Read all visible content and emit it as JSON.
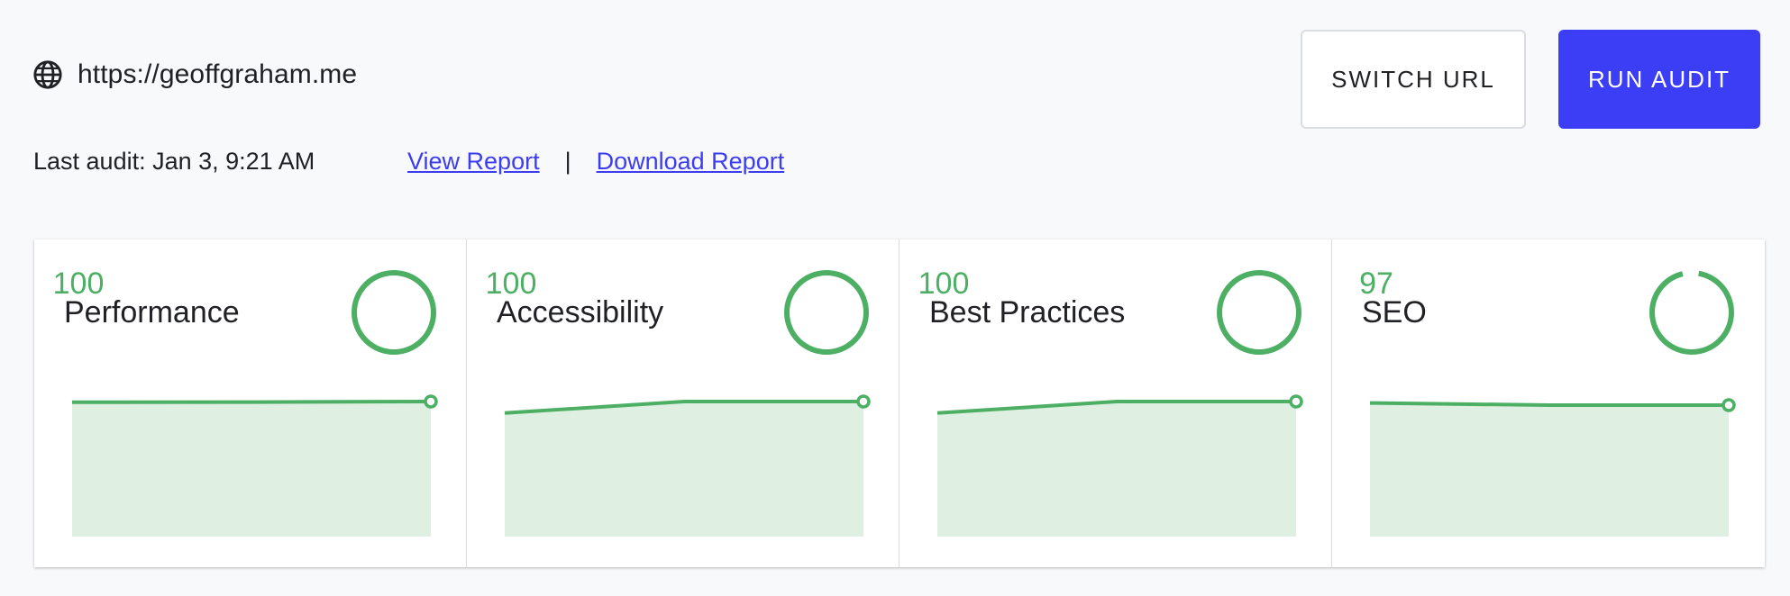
{
  "header": {
    "url": "https://geoffgraham.me",
    "globe_icon": "globe-icon",
    "last_audit": "Last audit: Jan 3, 9:21 AM",
    "view_report": "View Report",
    "separator": "|",
    "download_report": "Download Report"
  },
  "buttons": {
    "switch_url": "SWITCH URL",
    "run_audit": "RUN AUDIT"
  },
  "colors": {
    "accent": "#3b3ef5",
    "link": "#3d3df0",
    "good": "#4caf63",
    "good_fill": "#dff0e2"
  },
  "cards": [
    {
      "title": "Performance",
      "score": 100,
      "score_label": "100",
      "history": [
        99.5,
        99.6,
        100
      ]
    },
    {
      "title": "Accessibility",
      "score": 100,
      "score_label": "100",
      "history": [
        92,
        100,
        100
      ]
    },
    {
      "title": "Best Practices",
      "score": 100,
      "score_label": "100",
      "history": [
        92,
        100,
        100
      ]
    },
    {
      "title": "SEO",
      "score": 97,
      "score_label": "97",
      "history": [
        99,
        97.5,
        97.5
      ]
    }
  ]
}
